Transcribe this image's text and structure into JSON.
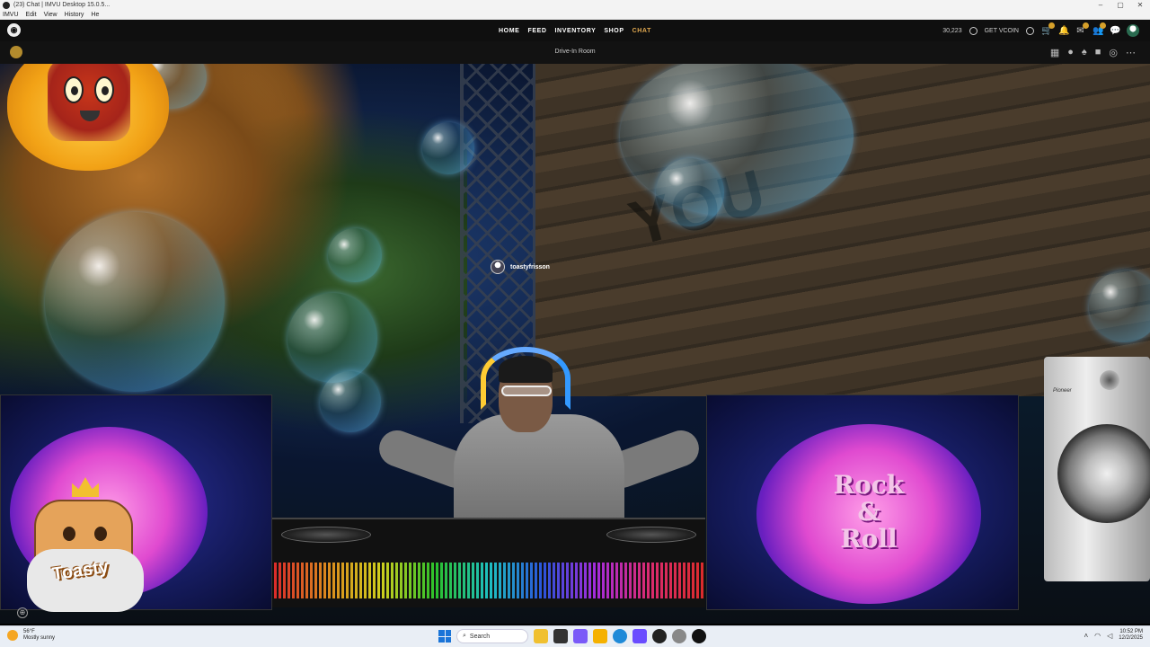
{
  "window": {
    "title": "(23) Chat | IMVU Desktop 15.0.5...",
    "controls": [
      "–",
      "▢",
      "✕"
    ]
  },
  "menubar": {
    "items": [
      "IMVU",
      "Edit",
      "View",
      "History",
      "He"
    ]
  },
  "nav": {
    "links": [
      "HOME",
      "FEED",
      "INVENTORY",
      "SHOP",
      "CHAT"
    ],
    "active": "CHAT",
    "credits": "30,223",
    "get_vcoin": "GET VCOIN",
    "icons": [
      "cart-icon",
      "bell-icon",
      "gift-icon",
      "people-icon",
      "chat-bubble-icon",
      "avatar-icon"
    ]
  },
  "room": {
    "title": "Drive-In Room",
    "tools": [
      "layout-icon",
      "chat-icon",
      "outfit-icon",
      "bag-icon",
      "camera-icon",
      "more-icon"
    ]
  },
  "scene": {
    "avatar_name": "toastyfrisson",
    "graffiti": "YOU",
    "sign_text": [
      "Rock",
      "&",
      "Roll"
    ],
    "mascot_label": "Toasty",
    "speaker_brand": "Pioneer"
  },
  "taskbar": {
    "weather_temp": "56°F",
    "weather_desc": "Mostly sunny",
    "search_placeholder": "Search",
    "time": "10:52 PM",
    "date": "12/2/2025"
  },
  "colors": {
    "accent": "#e0a850",
    "navbar": "#0f0f0f",
    "taskbar": "#e9eef5"
  }
}
